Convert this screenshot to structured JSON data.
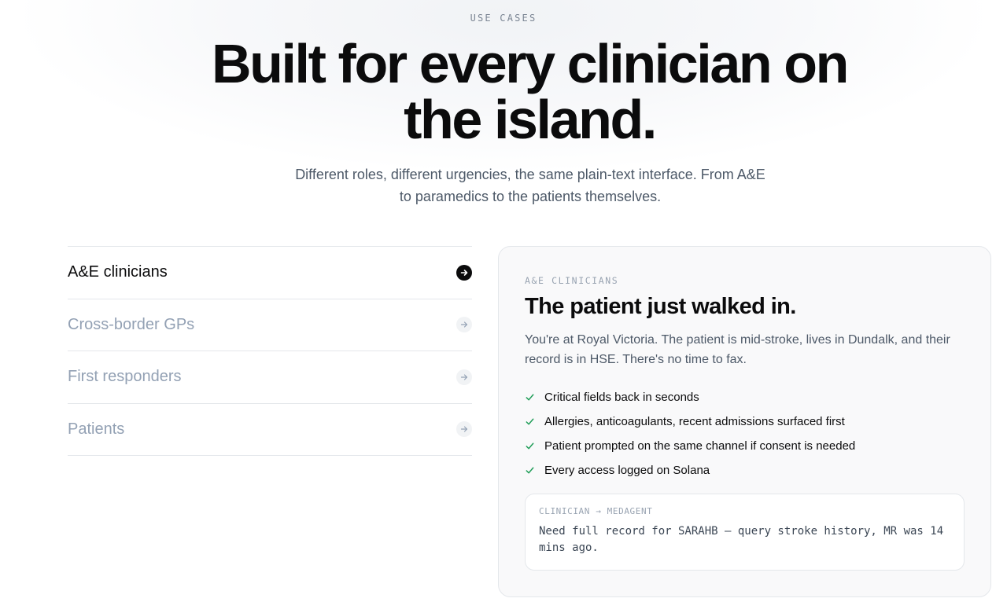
{
  "hero": {
    "eyebrow": "USE CASES",
    "headline": "Built for every clinician on the island.",
    "subhead": "Different roles, different urgencies, the same plain-text interface. From A&E to paramedics to the patients themselves."
  },
  "tabs": [
    {
      "label": "A&E clinicians",
      "active": true
    },
    {
      "label": "Cross-border GPs",
      "active": false
    },
    {
      "label": "First responders",
      "active": false
    },
    {
      "label": "Patients",
      "active": false
    }
  ],
  "panel": {
    "eyebrow": "A&E CLINICIANS",
    "title": "The patient just walked in.",
    "description": "You're at Royal Victoria. The patient is mid-stroke, lives in Dundalk, and their record is in HSE. There's no time to fax.",
    "checks": [
      "Critical fields back in seconds",
      "Allergies, anticoagulants, recent admissions surfaced first",
      "Patient prompted on the same channel if consent is needed",
      "Every access logged on Solana"
    ],
    "message": {
      "header": "CLINICIAN → MEDAGENT",
      "body": "Need full record for SARAHB — query stroke history, MR was 14 mins ago."
    }
  },
  "colors": {
    "accent_check": "#1f9d57",
    "inactive_text": "#93a1b4",
    "body_text": "#4d5968"
  },
  "icons": {
    "tab_arrow": "arrow-right-icon",
    "check": "check-icon"
  }
}
